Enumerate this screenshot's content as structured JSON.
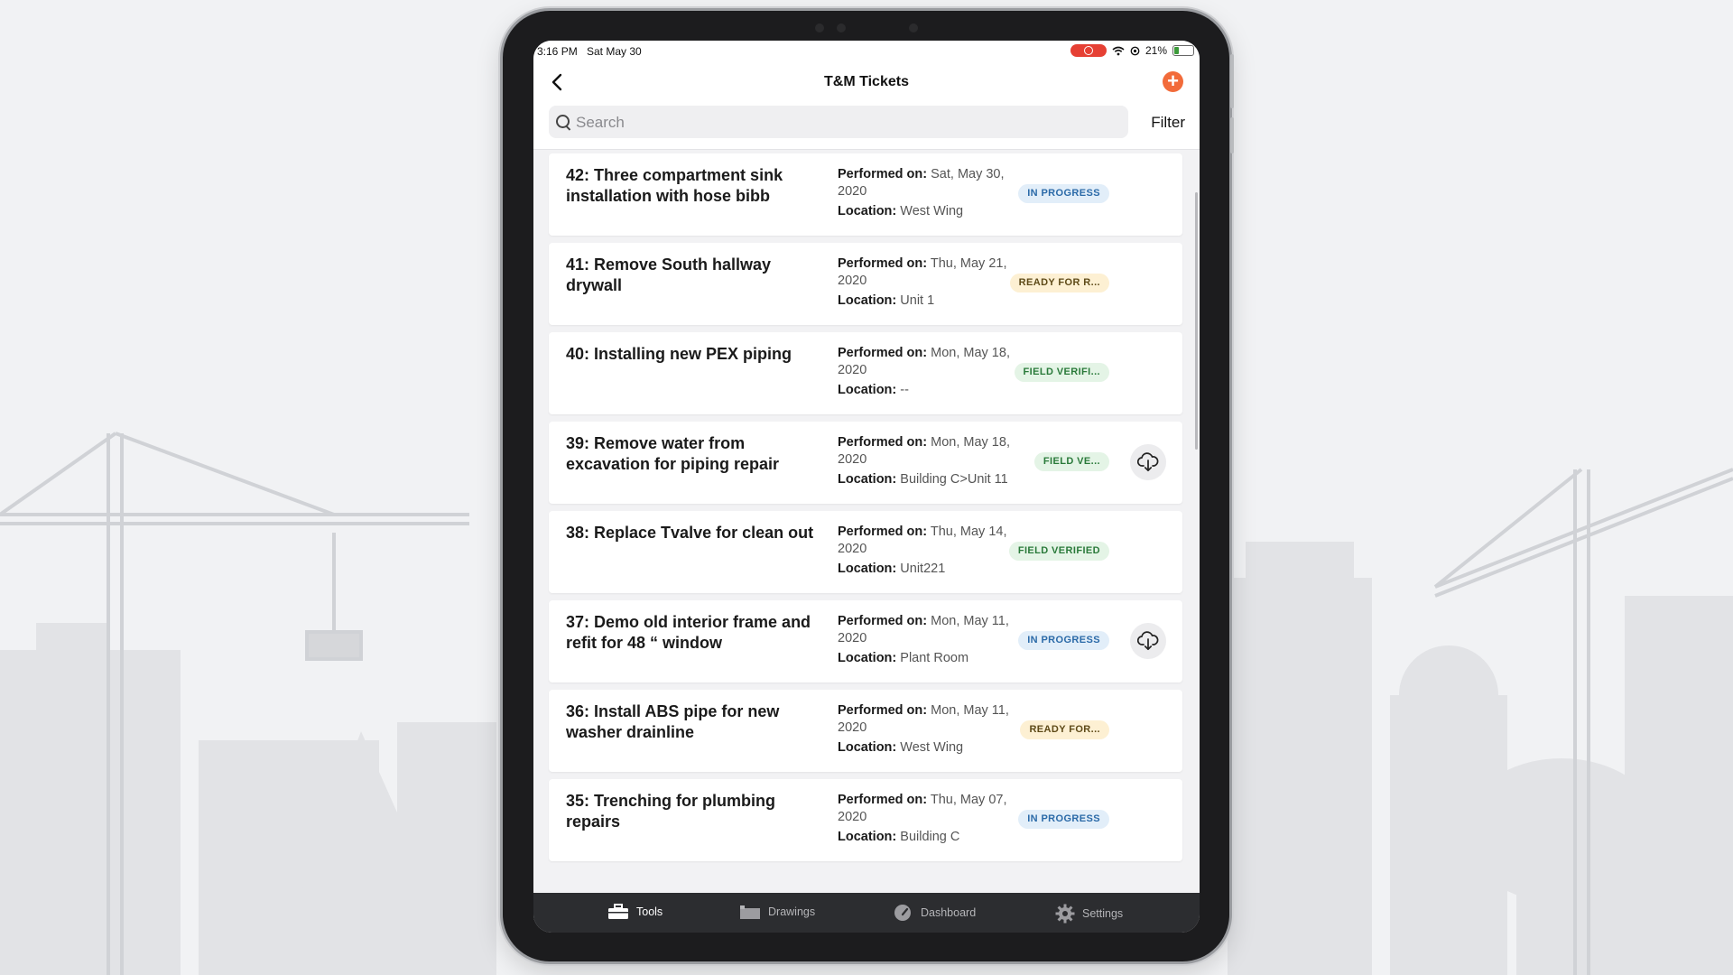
{
  "status": {
    "time": "3:16 PM",
    "date": "Sat May 30",
    "battery": "21%"
  },
  "nav": {
    "title": "T&M Tickets",
    "back_icon": "chevron-left-icon",
    "add_icon": "plus-circle-icon"
  },
  "search": {
    "placeholder": "Search",
    "value": "",
    "filter_label": "Filter"
  },
  "labels": {
    "performed_on": "Performed on:",
    "location": "Location:"
  },
  "tickets": [
    {
      "title": "42: Three compartment sink installation with hose bibb",
      "performed": "Sat, May 30, 2020",
      "location": "West Wing",
      "status": "IN PROGRESS",
      "download": false
    },
    {
      "title": "41: Remove South hallway drywall",
      "performed": "Thu, May 21, 2020",
      "location": "Unit 1",
      "status": "READY FOR R...",
      "download": false
    },
    {
      "title": "40: Installing new PEX piping",
      "performed": "Mon, May 18, 2020",
      "location": "--",
      "status": "FIELD VERIFI...",
      "download": false
    },
    {
      "title": "39: Remove water from excavation for piping repair",
      "performed": "Mon, May 18, 2020",
      "location": "Building C>Unit 11",
      "status": "FIELD VE...",
      "download": true
    },
    {
      "title": "38: Replace Tvalve for clean out",
      "performed": "Thu, May 14, 2020",
      "location": "Unit221",
      "status": "FIELD VERIFIED",
      "download": false
    },
    {
      "title": "37: Demo old interior frame and refit for 48 “ window",
      "performed": "Mon, May 11, 2020",
      "location": "Plant Room",
      "status": "IN PROGRESS",
      "download": true
    },
    {
      "title": "36: Install ABS pipe for new washer drainline",
      "performed": "Mon, May 11, 2020",
      "location": "West Wing",
      "status": "READY FOR...",
      "download": false
    },
    {
      "title": "35: Trenching for plumbing repairs",
      "performed": "Thu, May 07, 2020",
      "location": "Building C",
      "status": "IN PROGRESS",
      "download": false
    }
  ],
  "tabs": [
    {
      "label": "Tools",
      "icon": "toolbox-icon",
      "active": true
    },
    {
      "label": "Drawings",
      "icon": "drawings-icon",
      "active": false
    },
    {
      "label": "Dashboard",
      "icon": "gauge-icon",
      "active": false
    },
    {
      "label": "Settings",
      "icon": "gear-icon",
      "active": false
    }
  ],
  "colors": {
    "accent": "#f26b3a",
    "progress_bg": "#e2eef9",
    "progress_fg": "#2b6aa8",
    "ready_bg": "#fdf0d3",
    "ready_fg": "#5e4a18",
    "verified_bg": "#e4f4e6",
    "verified_fg": "#2a7a3a"
  }
}
